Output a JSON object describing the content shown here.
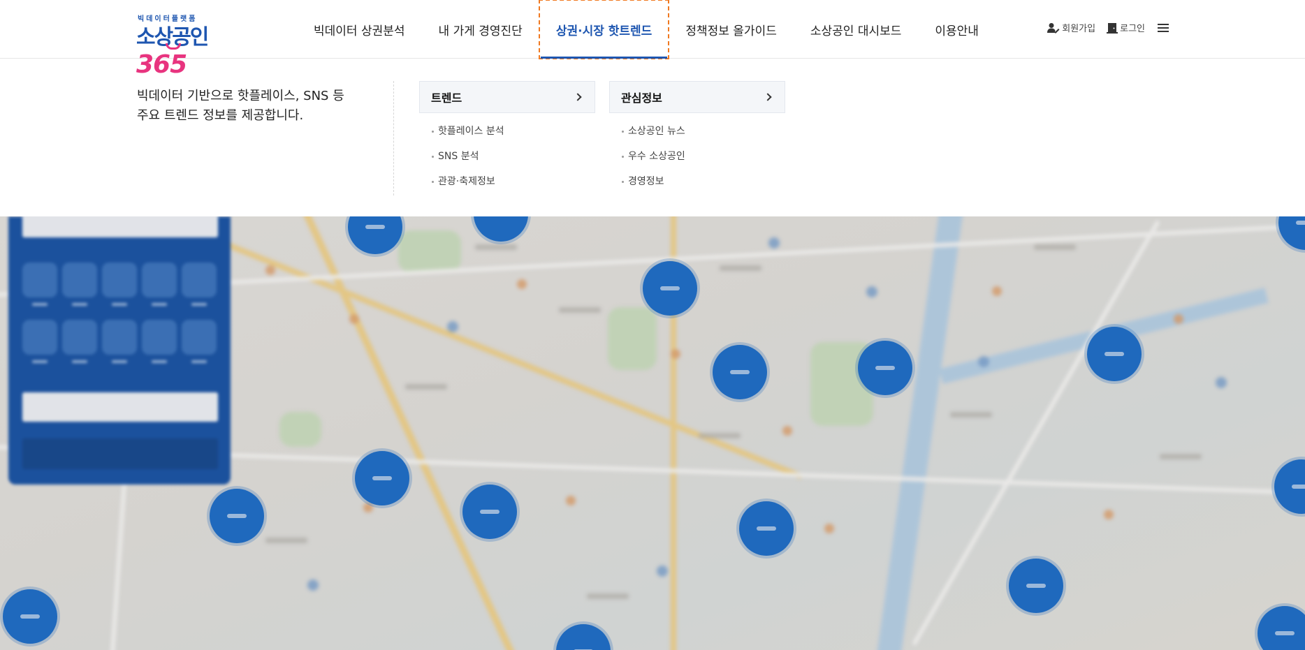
{
  "brand": {
    "tagline": "빅데이터플랫폼",
    "name": "소상공인",
    "number": "365",
    "primary_color": "#1e56b0",
    "accent_color": "#e8347f"
  },
  "gnb": {
    "items": [
      {
        "label": "빅데이터 상권분석"
      },
      {
        "label": "내 가게 경영진단"
      },
      {
        "label": "상권·시장 핫트렌드"
      },
      {
        "label": "정책정보 올가이드"
      },
      {
        "label": "소상공인 대시보드"
      },
      {
        "label": "이용안내"
      }
    ],
    "active_index": 2
  },
  "util": {
    "signup_label": "회원가입",
    "signup_icon": "user-edit-icon",
    "login_label": "로그인",
    "login_icon": "door-icon",
    "menu_icon": "hamburger-icon"
  },
  "mega": {
    "description_line1": "빅데이터 기반으로 핫플레이스, SNS 등",
    "description_line2": "주요 트렌드 정보를 제공합니다.",
    "columns": [
      {
        "title": "트렌드",
        "items": [
          "핫플레이스 분석",
          "SNS 분석",
          "관광·축제정보"
        ]
      },
      {
        "title": "관심정보",
        "items": [
          "소상공인 뉴스",
          "우수 소상공인",
          "경영정보"
        ]
      }
    ]
  }
}
